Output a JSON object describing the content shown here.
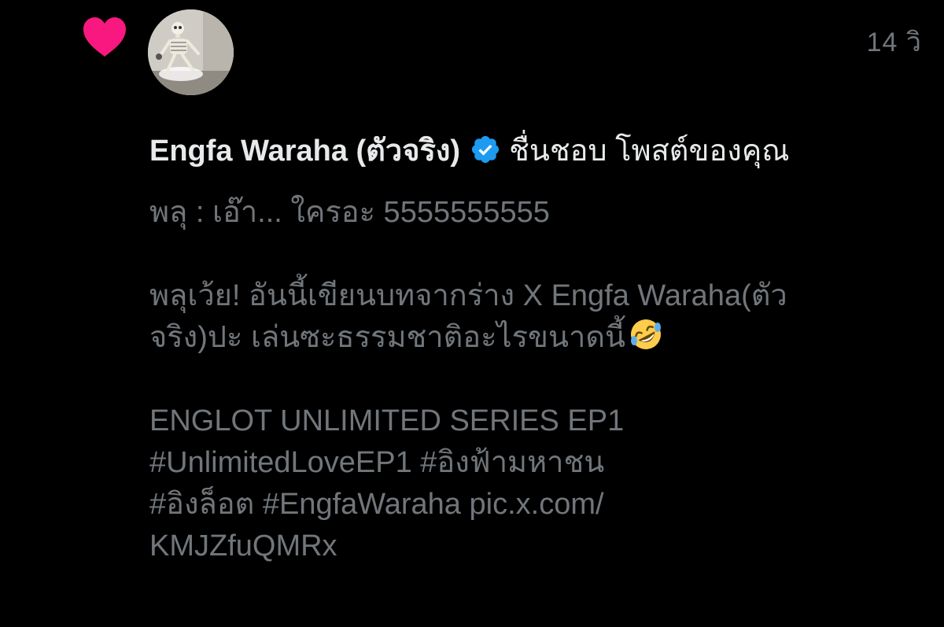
{
  "notification": {
    "type_icon": "heart-icon",
    "timestamp": "14 วิ",
    "author": {
      "name": "Engfa Waraha (ตัวจริง)",
      "verified": true,
      "avatar_icon": "skeleton-avatar"
    },
    "action_text": "ชื่นชอบ โพสต์ของคุณ",
    "post_lines": {
      "l1": "พลุ : เอ๊า... ใครอะ 5555555555",
      "l2": "พลุเว้ย! อันนี้เขียนบทจากร่าง X Engfa Waraha(ตัว",
      "l3": "จริง)ปะ เล่นซะธรรมชาติอะไรขนาดนี้",
      "l3_emoji": "rolling-on-floor-laughing-emoji",
      "l4": "ENGLOT UNLIMITED SERIES EP1",
      "l5": "#UnlimitedLoveEP1 #อิงฟ้ามหาชน",
      "l6": "#อิงล็อต #EngfaWaraha pic.x.com/",
      "l7": "KMJZfuQMRx"
    },
    "colors": {
      "background": "#000000",
      "heart": "#f91880",
      "verified": "#1d9bf0",
      "primary_text": "#e7e9ea",
      "secondary_text": "#71767b"
    }
  }
}
